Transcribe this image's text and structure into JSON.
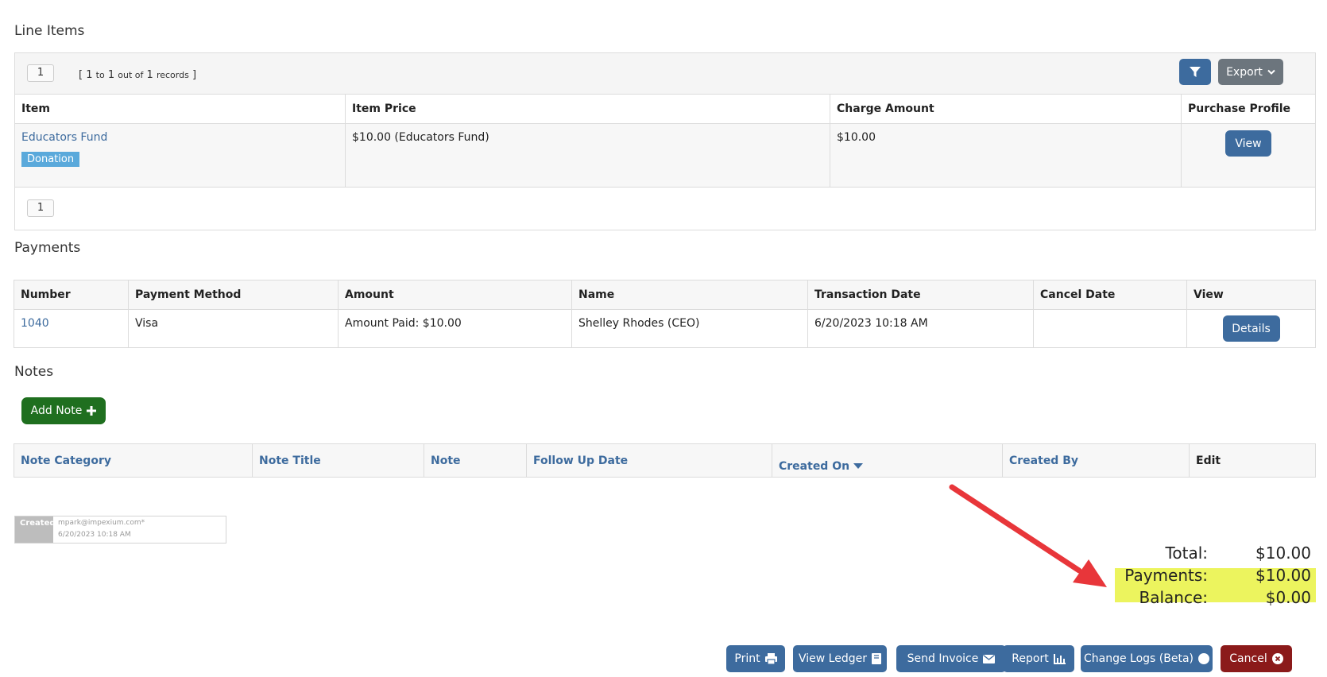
{
  "line_items": {
    "title": "Line Items",
    "page_number": "1",
    "records": {
      "open": "[",
      "from": "1",
      "to_word": "to",
      "to": "1",
      "out_of": "out of",
      "total": "1",
      "records_word": "records",
      "close": "]"
    },
    "export_label": "Export",
    "columns": [
      "Item",
      "Item Price",
      "Charge Amount",
      "Purchase Profile"
    ],
    "rows": [
      {
        "item": "Educators Fund",
        "tag": "Donation",
        "price": "$10.00 (Educators Fund)",
        "charge": "$10.00",
        "action": "View"
      }
    ],
    "footer_page": "1"
  },
  "payments": {
    "title": "Payments",
    "columns": [
      "Number",
      "Payment Method",
      "Amount",
      "Name",
      "Transaction Date",
      "Cancel Date",
      "View"
    ],
    "rows": [
      {
        "number": "1040",
        "method": "Visa",
        "amount": "Amount Paid: $10.00",
        "name": "Shelley Rhodes (CEO)",
        "date": "6/20/2023 10:18 AM",
        "cancel": "",
        "action": "Details"
      }
    ]
  },
  "notes": {
    "title": "Notes",
    "add_label": "Add Note",
    "columns": [
      "Note Category",
      "Note Title",
      "Note",
      "Follow Up Date",
      "Created On",
      "Created By",
      "Edit"
    ]
  },
  "created_stamp": {
    "label": "Created",
    "by": "mpark@impexium.com*",
    "on": "6/20/2023 10:18 AM"
  },
  "totals": {
    "total_label": "Total:",
    "total_value": "$10.00",
    "payments_label": "Payments:",
    "payments_value": "$10.00",
    "balance_label": "Balance:",
    "balance_value": "$0.00"
  },
  "actions": {
    "print": "Print",
    "view_ledger": "View Ledger",
    "send_invoice": "Send Invoice",
    "report": "Report",
    "change_logs": "Change Logs (Beta)",
    "cancel": "Cancel"
  },
  "colors": {
    "primary": "#3d6b9e",
    "success": "#1f6f1f",
    "danger": "#8b1a1a",
    "highlight": "#ecf45e",
    "arrow": "#e8363a",
    "tag": "#5aa9db"
  },
  "icons": [
    "filter-icon",
    "chevron-down-icon",
    "plus-icon",
    "caret-down-icon",
    "print-icon",
    "book-icon",
    "envelope-icon",
    "bar-chart-icon",
    "circle-icon",
    "close-circle-icon"
  ]
}
